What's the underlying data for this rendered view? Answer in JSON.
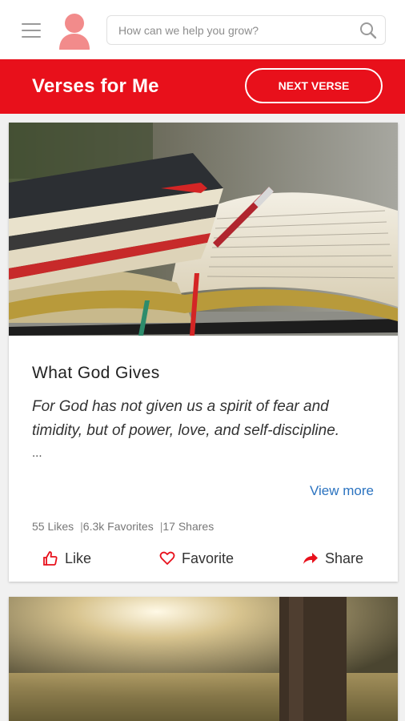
{
  "topbar": {
    "search_placeholder": "How can we help you grow?"
  },
  "header": {
    "title": "Verses for Me",
    "next_button": "NEXT VERSE"
  },
  "card": {
    "title": "What God Gives",
    "verse": "For God has not given us a spirit of fear and timidity, but of power, love, and self-discipline.",
    "ellipsis": "...",
    "view_more": "View more",
    "stats": {
      "likes": "55 Likes",
      "favorites": "6.3k Favorites",
      "shares": "17 Shares",
      "separator": "|"
    },
    "actions": {
      "like": "Like",
      "favorite": "Favorite",
      "share": "Share"
    }
  },
  "colors": {
    "brand_red": "#e8101b",
    "link_blue": "#2b73c0",
    "avatar_pink": "#f28b8b"
  }
}
